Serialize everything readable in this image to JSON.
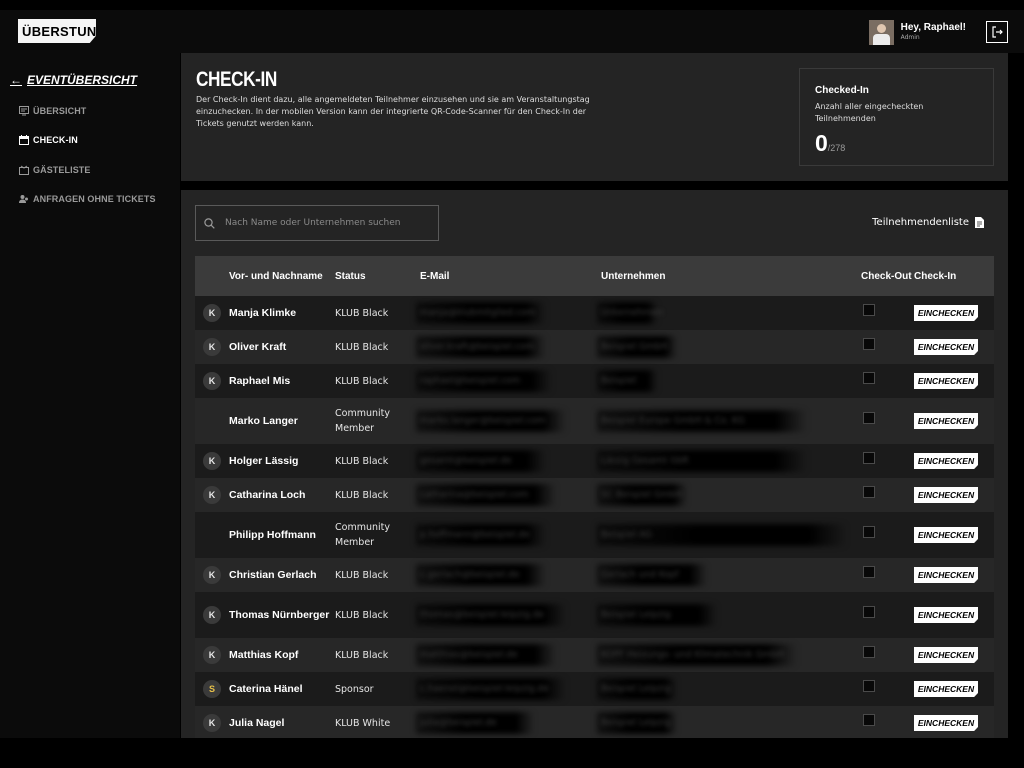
{
  "app": {
    "logo": "ÜBERSTUNDE®"
  },
  "user": {
    "greeting": "Hey, Raphael!",
    "role": "Admin"
  },
  "sidebar": {
    "back_label": "EVENTÜBERSICHT",
    "items": [
      {
        "label": "ÜBERSICHT",
        "icon": "overview-icon",
        "active": false
      },
      {
        "label": "CHECK-IN",
        "icon": "calendar-icon",
        "active": true
      },
      {
        "label": "GÄSTELISTE",
        "icon": "guestlist-icon",
        "active": false
      },
      {
        "label": "ANFRAGEN OHNE TICKETS",
        "icon": "people-icon",
        "active": false
      }
    ]
  },
  "header": {
    "title": "CHECK-IN",
    "description": "Der Check-In dient dazu, alle angemeldeten Teilnehmer einzusehen und sie am Veranstaltungstag einzuchecken. In der mobilen Version kann der integrierte QR-Code-Scanner für den Check-In der Tickets genutzt werden kann.",
    "stats": {
      "title": "Checked-In",
      "description": "Anzahl aller eingecheckten Teilnehmenden",
      "value": "0",
      "total": "/278"
    }
  },
  "search": {
    "placeholder": "Nach Name oder Unternehmen suchen"
  },
  "export": {
    "label": "Teilnehmendenliste"
  },
  "table": {
    "columns": [
      "",
      "Vor- und Nachname",
      "Status",
      "E-Mail",
      "Unternehmen",
      "Check-Out",
      "Check-In"
    ],
    "checkin_button_label": "EINCHECKEN",
    "rows": [
      {
        "badge": "K",
        "name": "Manja Klimke",
        "status": "KLUB Black",
        "email": "manja@klubmitglied.com",
        "company": "Unternehmen",
        "checked_out": false
      },
      {
        "badge": "K",
        "name": "Oliver Kraft",
        "status": "KLUB Black",
        "email": "oliver.kraft@beispiel.com",
        "company": "Beispiel GmbH",
        "checked_out": false
      },
      {
        "badge": "K",
        "name": "Raphael Mis",
        "status": "KLUB Black",
        "email": "raphael@beispiel.com",
        "company": "Beispiel",
        "checked_out": false
      },
      {
        "badge": "",
        "name": "Marko Langer",
        "status": "Community Member",
        "email": "marko.langer@beispiel.com",
        "company": "Beispiel Europe GmbH & Co. KG",
        "checked_out": false
      },
      {
        "badge": "K",
        "name": "Holger Lässig",
        "status": "KLUB Black",
        "email": "gesamt@beispiel.de",
        "company": "Lässig Gesamt GbR",
        "checked_out": false
      },
      {
        "badge": "K",
        "name": "Catharina Loch",
        "status": "KLUB Black",
        "email": "catharina@beispiel.com",
        "company": "SC Beispiel GmbH",
        "checked_out": false
      },
      {
        "badge": "",
        "name": "Philipp Hoffmann",
        "status": "Community Member",
        "email": "p.hoffmann@beispiel.de",
        "company": "Beispiel AG",
        "checked_out": false
      },
      {
        "badge": "K",
        "name": "Christian Gerlach",
        "status": "KLUB Black",
        "email": "c.gerlach@beispiel.de",
        "company": "Gerlach und Kopf",
        "checked_out": false
      },
      {
        "badge": "K",
        "name": "Thomas Nürnberger",
        "status": "KLUB Black",
        "email": "thomas@beispiel-leipzig.de",
        "company": "Beispiel Leipzig",
        "checked_out": false
      },
      {
        "badge": "K",
        "name": "Matthias Kopf",
        "status": "KLUB Black",
        "email": "matthias@beispiel.de",
        "company": "KOPF Heizungs- und Klimatechnik GmbH",
        "checked_out": false
      },
      {
        "badge": "S",
        "name": "Caterina Hänel",
        "status": "Sponsor",
        "email": "c.haenel@beispiel-leipzig.de",
        "company": "Beispiel Leipzig",
        "checked_out": false
      },
      {
        "badge": "K",
        "name": "Julia Nagel",
        "status": "KLUB White",
        "email": "julia@beispiel.de",
        "company": "Beispiel Leipzig",
        "checked_out": false
      }
    ]
  },
  "colors": {
    "sponsor_badge": "#e7c14a",
    "background": "#0b0b0b",
    "card": "#242424"
  }
}
